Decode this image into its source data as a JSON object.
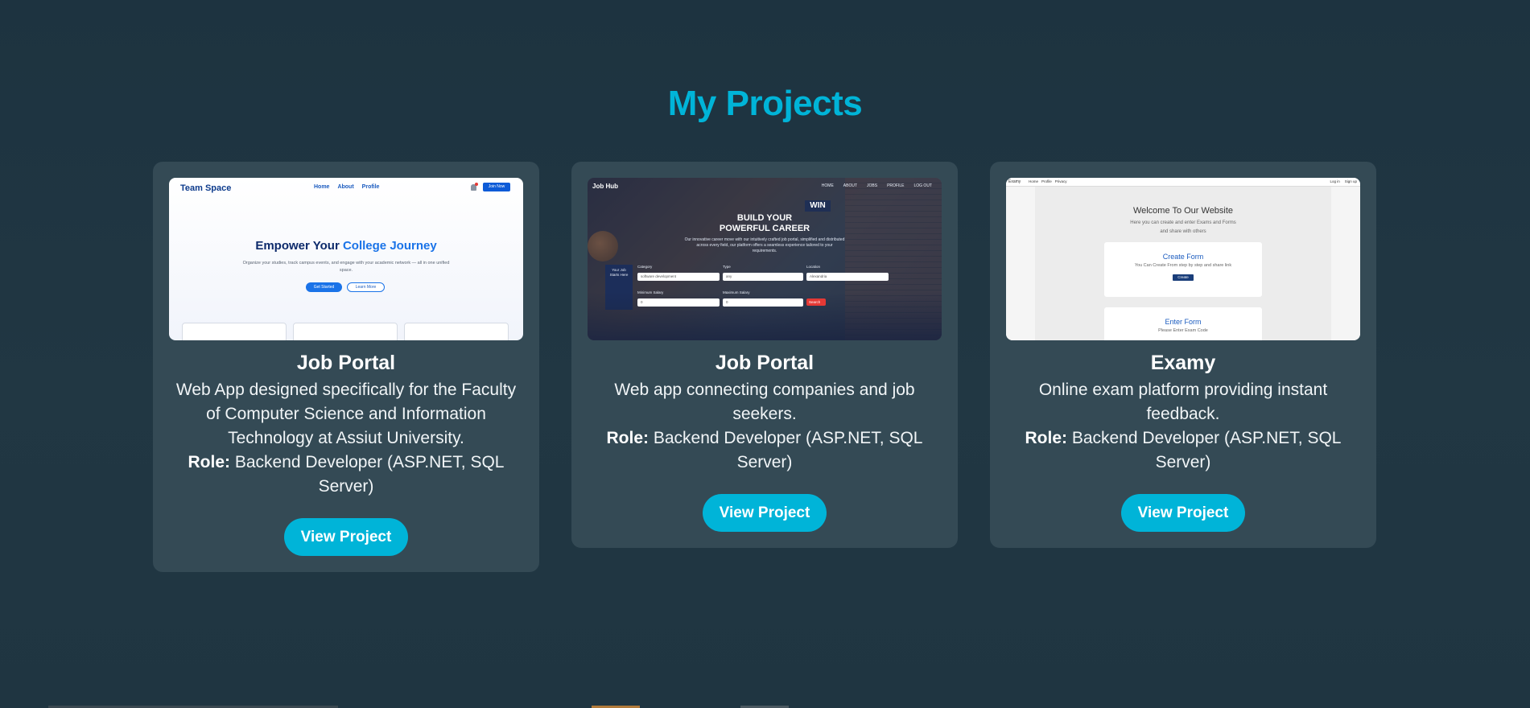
{
  "section": {
    "title": "My Projects"
  },
  "projects": [
    {
      "title": "Job Portal",
      "description": "Web App designed specifically for the Faculty of Computer Science and Information Technology at Assiut University.",
      "role_label": "Role:",
      "role_value": "Backend Developer (ASP.NET, SQL Server)",
      "button_label": "View Project",
      "thumbnail": {
        "brand": "Team Space",
        "nav": [
          "Home",
          "About",
          "Profile"
        ],
        "cta": "Join Now",
        "headline_a": "Empower Your ",
        "headline_b": "College Journey",
        "subtext": "Organize your studies, track campus events, and engage with your academic network — all in one unified space.",
        "btn_primary": "Get Started",
        "btn_secondary": "Learn More"
      }
    },
    {
      "title": "Job Portal",
      "description": "Web app connecting companies and job seekers.",
      "role_label": "Role:",
      "role_value": "Backend Developer (ASP.NET, SQL Server)",
      "button_label": "View Project",
      "thumbnail": {
        "brand": "Job Hub",
        "nav": [
          "HOME",
          "ABOUT",
          "JOBS",
          "PROFILE",
          "LOG OUT"
        ],
        "sign": "WIN",
        "headline": "BUILD YOUR POWERFUL CAREER",
        "subtext": "Our innovative career move with our intuitively crafted job portal, simplified and distributed across every field, our platform offers a seamless experience tailored to your requirements.",
        "labels": [
          "Category",
          "Type",
          "Location",
          "Minimum Salary",
          "Maximum Salary"
        ],
        "values": [
          "software development",
          "any",
          "Alexandria",
          "0",
          "0"
        ],
        "search": "Search",
        "board": "Your Job Starts Here"
      }
    },
    {
      "title": "Examy",
      "description": "Online exam platform providing instant feedback.",
      "role_label": "Role:",
      "role_value": "Backend Developer (ASP.NET, SQL Server)",
      "button_label": "View Project",
      "thumbnail": {
        "brand": "Examy",
        "nav": [
          "Home",
          "Profile",
          "Privacy"
        ],
        "auth": [
          "Log in",
          "Sign up"
        ],
        "welcome": "Welcome To Our Website",
        "welcome_sub_1": "Here you can create and enter Exams and Forms",
        "welcome_sub_2": "and share with others",
        "create_title": "Create Form",
        "create_desc": "You Can Create From step by step and share link",
        "create_btn": "Create",
        "enter_title": "Enter Form",
        "enter_desc": "Please Enter Exam Code"
      }
    }
  ]
}
